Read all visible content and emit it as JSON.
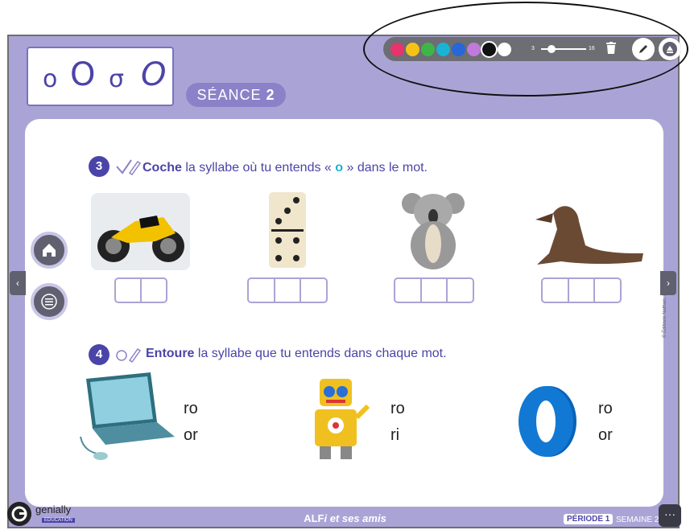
{
  "letters": {
    "a": "o",
    "b": "O",
    "c": "σ",
    "d": "O"
  },
  "seance": {
    "label": "SÉANCE",
    "number": "2"
  },
  "toolbar": {
    "colors": [
      "#e8336d",
      "#f7c216",
      "#3fb549",
      "#19b4d4",
      "#2767d6",
      "#c07ad9",
      "#111111",
      "#ffffff"
    ],
    "size_min": "3",
    "size_max": "16",
    "trash_icon": "trash-icon",
    "pencil_icon": "pencil-icon",
    "close_icon": "toolbar-toggle-icon"
  },
  "exercise3": {
    "number": "3",
    "verb": "Coche",
    "text_a": " la syllabe où tu entends « ",
    "letter": "o",
    "text_b": " » dans le mot.",
    "images": [
      "moto",
      "domino",
      "koala",
      "otarie"
    ],
    "syllable_counts": [
      2,
      3,
      3,
      3
    ]
  },
  "exercise4": {
    "number": "4",
    "verb": "Entoure",
    "text": " la syllabe que tu entends dans chaque mot.",
    "items": [
      {
        "image": "ordinateur",
        "opt1": "ro",
        "opt2": "or"
      },
      {
        "image": "robot",
        "opt1": "ro",
        "opt2": "ri"
      },
      {
        "image": "lettre-o",
        "opt1": "ro",
        "opt2": "or"
      }
    ]
  },
  "nav": {
    "prev": "‹",
    "next": "›",
    "home_icon": "home-icon",
    "menu_icon": "menu-icon"
  },
  "footer": {
    "brand": "genially",
    "brand_sub": "EDUCATION",
    "title_a": "ALF",
    "title_b": "i et ses amis",
    "periode_label": "PÉRIODE",
    "periode_num": "1",
    "semaine": "SEMAINE 2",
    "more": "···"
  },
  "copyright": "© Éditions Nathan, 2022"
}
